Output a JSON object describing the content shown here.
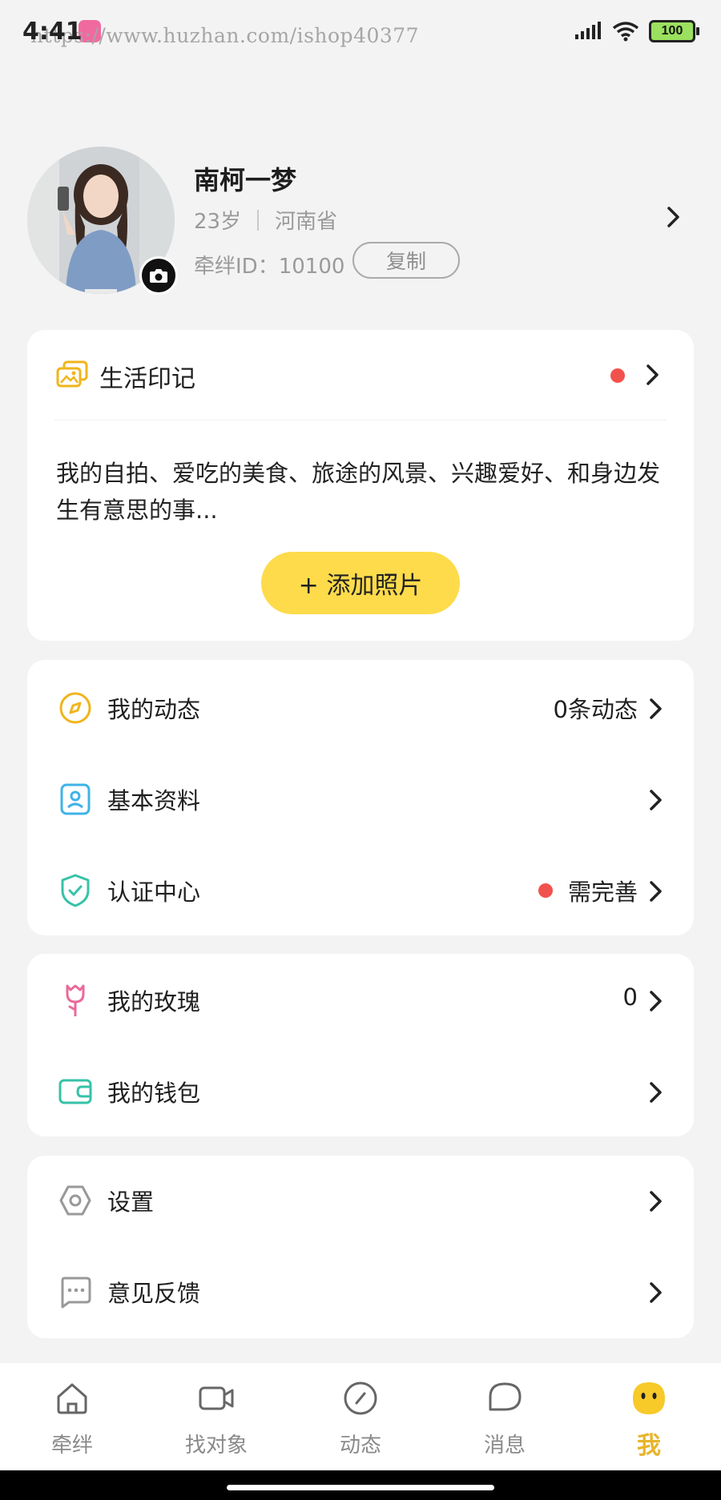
{
  "status_bar": {
    "time": "4:41",
    "watermark": "https://www.huzhan.com/ishop40377",
    "battery": "100",
    "icons": [
      "signal-icon",
      "wifi-icon",
      "battery-icon"
    ]
  },
  "profile": {
    "name": "南柯一梦",
    "age": "23岁",
    "location": "河南省",
    "id_text": "牵绊ID：10100",
    "copy_label": "复制"
  },
  "life_record": {
    "title": "生活印记",
    "description": "我的自拍、爱吃的美食、旅途的风景、兴趣爱好、和身边发生有意思的事...",
    "add_button": "+ 添加照片"
  },
  "menu_group_1": [
    {
      "label": "我的动态",
      "value": "0条动态",
      "icon": "compass-icon"
    },
    {
      "label": "基本资料",
      "value": "",
      "icon": "profile-card-icon"
    },
    {
      "label": "认证中心",
      "value": "需完善",
      "icon": "shield-check-icon"
    }
  ],
  "menu_group_2": [
    {
      "label": "我的玫瑰",
      "value": "0",
      "icon": "rose-icon"
    },
    {
      "label": "我的钱包",
      "value": "",
      "icon": "wallet-icon"
    }
  ],
  "menu_group_3": [
    {
      "label": "设置",
      "value": "",
      "icon": "gear-icon"
    },
    {
      "label": "意见反馈",
      "value": "",
      "icon": "feedback-icon"
    }
  ],
  "tabs": [
    {
      "label": "牵绊",
      "icon": "home-icon"
    },
    {
      "label": "找对象",
      "icon": "video-camera-icon"
    },
    {
      "label": "动态",
      "icon": "compass-icon"
    },
    {
      "label": "消息",
      "icon": "message-icon"
    },
    {
      "label": "我",
      "icon": "smiley-icon",
      "active": true
    }
  ],
  "colors": {
    "accent_yellow": "#fddb4b",
    "active_tab": "#e7b52b",
    "alert_red": "#f2524d",
    "background": "#f3f3f3"
  }
}
